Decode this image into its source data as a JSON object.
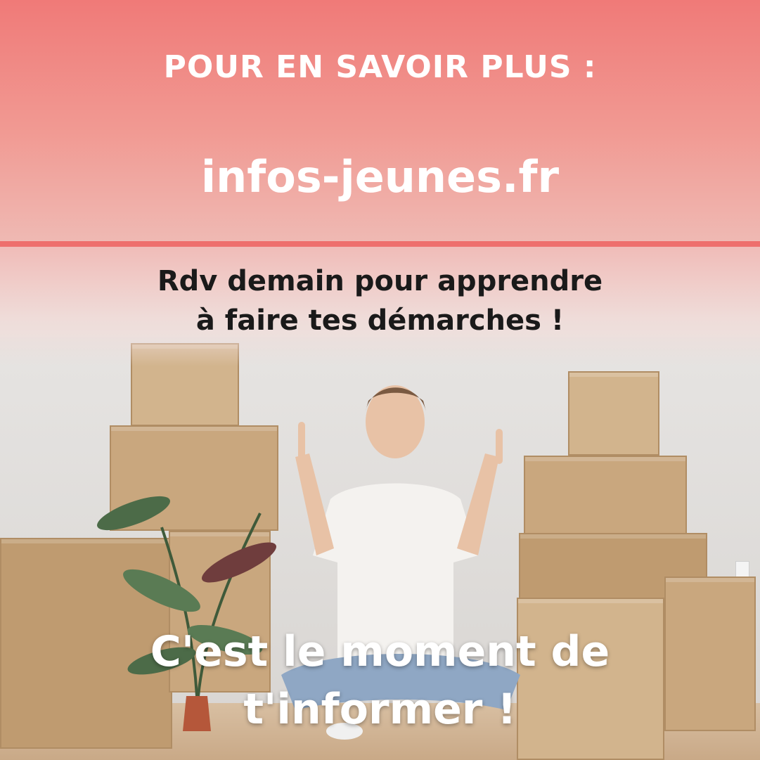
{
  "banner": {
    "heading": "POUR EN SAVOIR PLUS :",
    "website": "infos-jeunes.fr",
    "background_color": "#f07a78",
    "line_color": "#ee6f6d"
  },
  "subtitle": {
    "line1": "Rdv demain pour apprendre",
    "line2": "à faire tes démarches !"
  },
  "call_to_action": {
    "line1": "C'est le moment de",
    "line2": "t'informer !"
  },
  "photo": {
    "description_icon": "person-with-moving-boxes-photo"
  }
}
